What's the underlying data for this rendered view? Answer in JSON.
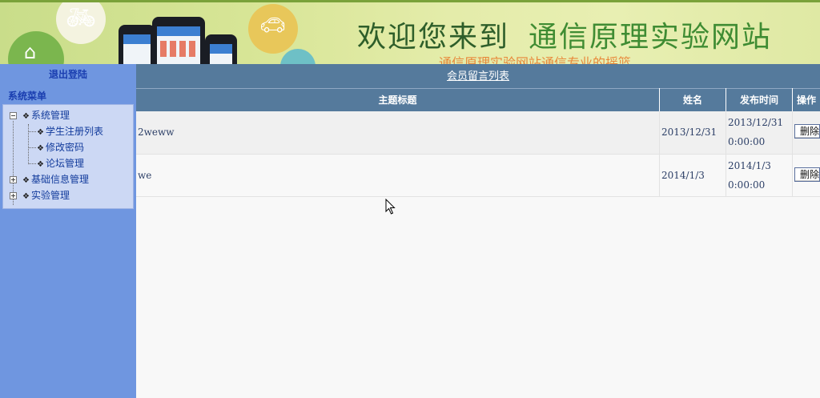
{
  "banner": {
    "title_part1": "欢迎您来到",
    "title_part2": "通信原理实验网站",
    "subtitle": "通信原理实验网站通信专业的摇篮",
    "accent": "#3f8c33"
  },
  "sidebar": {
    "logout_label": "退出登陆",
    "menu_title": "系统菜单",
    "tree": [
      {
        "label": "系统管理",
        "expanded": true,
        "children": [
          {
            "label": "学生注册列表"
          },
          {
            "label": "修改密码"
          },
          {
            "label": "论坛管理"
          }
        ]
      },
      {
        "label": "基础信息管理",
        "expanded": false
      },
      {
        "label": "实验管理",
        "expanded": false
      }
    ]
  },
  "main": {
    "page_title": "会员留言列表",
    "columns": [
      "主题标题",
      "姓名",
      "发布时间",
      "操作"
    ],
    "rows": [
      {
        "title": "2weww",
        "name": "2013/12/31",
        "time_date": "2013/12/31",
        "time_clock": "0:00:00",
        "action": "删除"
      },
      {
        "title": "we",
        "name": "2014/1/3",
        "time_date": "2014/1/3",
        "time_clock": "0:00:00",
        "action": "删除"
      }
    ]
  },
  "colors": {
    "sidebar_bg": "#6f96e0",
    "header_bg": "#557a9c",
    "link": "#1a3eb0"
  }
}
